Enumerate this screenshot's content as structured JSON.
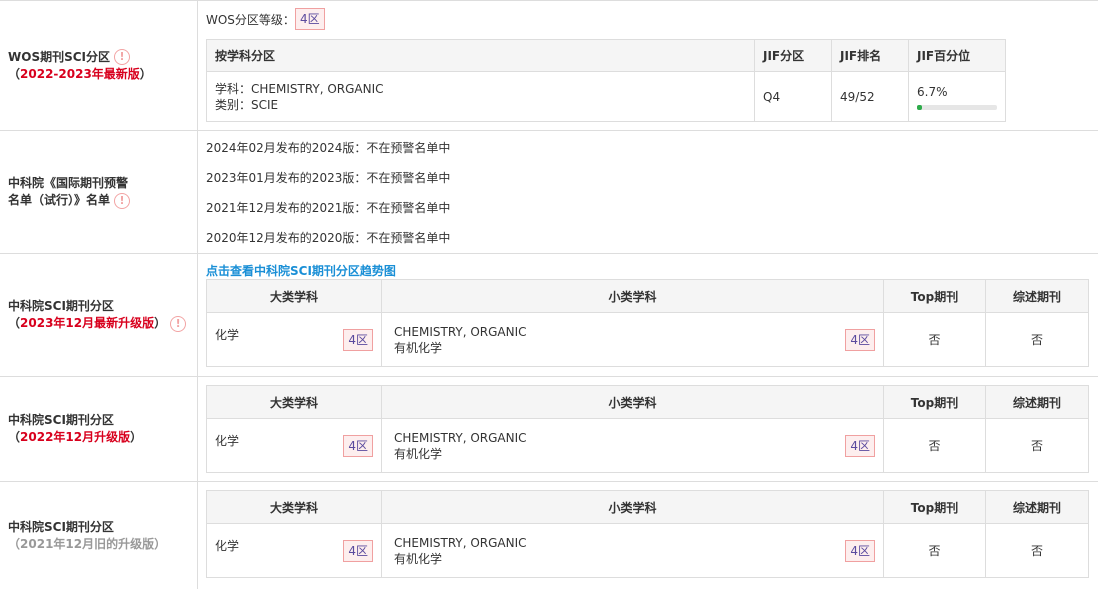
{
  "wos": {
    "label": "WOS期刊SCI分区",
    "sub_open": "（",
    "sub": "2022-2023年最新版",
    "sub_close": "）",
    "grade_label": "WOS分区等级：",
    "grade": "4区",
    "headers": [
      "按学科分区",
      "JIF分区",
      "JIF排名",
      "JIF百分位"
    ],
    "row": {
      "subject_line": "学科：CHEMISTRY, ORGANIC",
      "category_line": "类别：SCIE",
      "jif_zone": "Q4",
      "jif_rank": "49/52",
      "jif_percentile_text": "6.7%",
      "jif_percentile": 6.7
    }
  },
  "warning_list": {
    "label_line1": "中科院《国际期刊预警",
    "label_line2": "名单（试行）》名单",
    "items": [
      "2024年02月发布的2024版：不在预警名单中",
      "2023年01月发布的2023版：不在预警名单中",
      "2021年12月发布的2021版：不在预警名单中",
      "2020年12月发布的2020版：不在预警名单中"
    ]
  },
  "cas_link": "点击查看中科院SCI期刊分区趋势图",
  "cas_headers": [
    "大类学科",
    "小类学科",
    "Top期刊",
    "综述期刊"
  ],
  "cas_sections": [
    {
      "label": "中科院SCI期刊分区",
      "sub_open": "（",
      "sub": "2023年12月最新升级版",
      "sub_close": "）",
      "major": "化学",
      "major_zone": "4区",
      "minor_en": "CHEMISTRY, ORGANIC",
      "minor_cn": "有机化学",
      "minor_zone": "4区",
      "top": "否",
      "review": "否"
    },
    {
      "label": "中科院SCI期刊分区",
      "sub_open": "（",
      "sub": "2022年12月升级版",
      "sub_close": "）",
      "major": "化学",
      "major_zone": "4区",
      "minor_en": "CHEMISTRY, ORGANIC",
      "minor_cn": "有机化学",
      "minor_zone": "4区",
      "top": "否",
      "review": "否"
    },
    {
      "label": "中科院SCI期刊分区",
      "sub_open": "（",
      "sub": "2021年12月旧的升级版",
      "sub_close": "）",
      "major": "化学",
      "major_zone": "4区",
      "minor_en": "CHEMISTRY, ORGANIC",
      "minor_cn": "有机化学",
      "minor_zone": "4区",
      "top": "否",
      "review": "否"
    }
  ],
  "colors": {
    "accent_red": "#d8001d",
    "link_blue": "#1a8fd6",
    "progress_green": "#2dab4a"
  }
}
